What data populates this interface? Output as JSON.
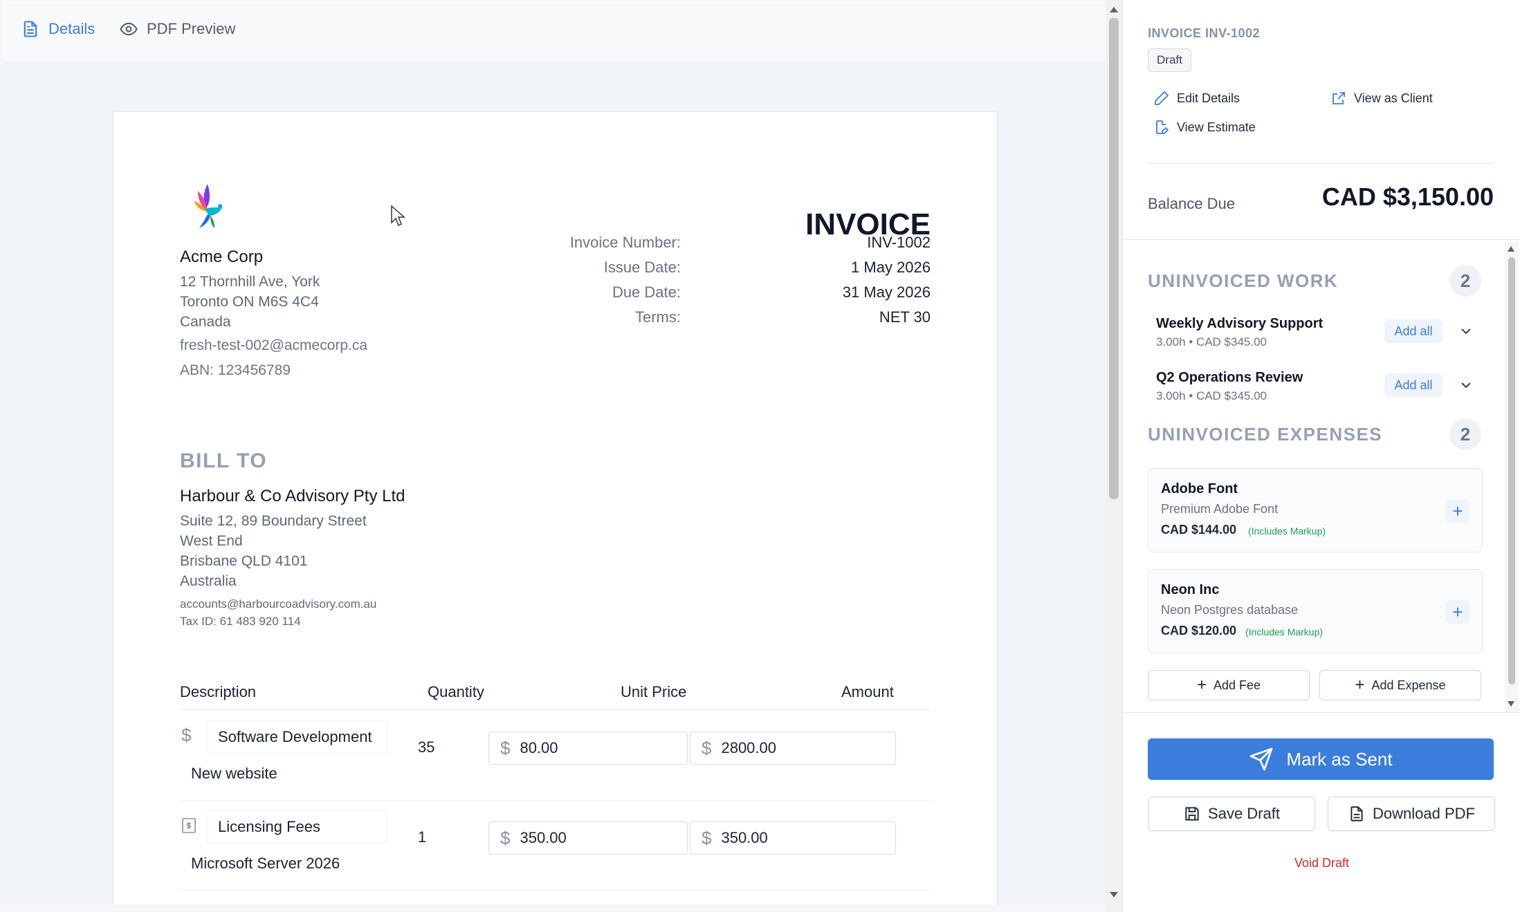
{
  "tabs": {
    "details": "Details",
    "preview": "PDF Preview"
  },
  "invoice": {
    "heading": "INVOICE",
    "meta": [
      {
        "label": "Invoice Number:",
        "value": "INV-1002"
      },
      {
        "label": "Issue Date:",
        "value": "1 May 2026"
      },
      {
        "label": "Due Date:",
        "value": "31 May 2026"
      },
      {
        "label": "Terms:",
        "value": "NET 30"
      }
    ],
    "company": {
      "name": "Acme Corp",
      "address1": "12 Thornhill Ave, York",
      "address2": "Toronto ON M6S 4C4",
      "country": "Canada",
      "email": "fresh-test-002@acmecorp.ca",
      "abn": "ABN: 123456789"
    },
    "bill_to": {
      "heading": "BILL TO",
      "name": "Harbour & Co Advisory Pty Ltd",
      "address1": "Suite 12, 89 Boundary Street",
      "address2": "West End",
      "address3": "Brisbane QLD 4101",
      "country": "Australia",
      "email": "accounts@harbourcoadvisory.com.au",
      "tax_id": "Tax ID: 61 483 920 114"
    },
    "columns": {
      "description": "Description",
      "quantity": "Quantity",
      "unit_price": "Unit Price",
      "amount": "Amount"
    },
    "lines": [
      {
        "title": "Software Development",
        "detail": "New website",
        "quantity": "35",
        "unit_price": "80.00",
        "amount": "2800.00",
        "currency_symbol": "$",
        "icon": "dollar-icon"
      },
      {
        "title": "Licensing Fees",
        "detail": "Microsoft Server 2026",
        "quantity": "1",
        "unit_price": "350.00",
        "amount": "350.00",
        "currency_symbol": "$",
        "icon": "receipt-icon"
      }
    ]
  },
  "panel": {
    "invoice_label": "INVOICE INV-1002",
    "status": "Draft",
    "actions": {
      "edit": "Edit Details",
      "view_client": "View as Client",
      "view_estimate": "View Estimate"
    },
    "balance_label": "Balance Due",
    "balance_value": "CAD $3,150.00",
    "uninvoiced_work": {
      "heading": "UNINVOICED WORK",
      "count": "2",
      "items": [
        {
          "title": "Weekly Advisory Support",
          "sub": "3.00h • CAD $345.00",
          "action": "Add all"
        },
        {
          "title": "Q2 Operations Review",
          "sub": "3.00h • CAD $345.00",
          "action": "Add all"
        }
      ]
    },
    "uninvoiced_expenses": {
      "heading": "UNINVOICED EXPENSES",
      "count": "2",
      "items": [
        {
          "title": "Adobe Font",
          "sub": "Premium Adobe Font",
          "amount": "CAD $144.00",
          "markup": "(Includes Markup)"
        },
        {
          "title": "Neon Inc",
          "sub": "Neon Postgres database",
          "amount": "CAD $120.00",
          "markup": "(Includes Markup)"
        }
      ]
    },
    "add_fee": "Add Fee",
    "add_expense": "Add Expense",
    "mark_sent": "Mark as Sent",
    "save_draft": "Save Draft",
    "download_pdf": "Download PDF",
    "void_draft": "Void Draft"
  },
  "colors": {
    "accent": "#3b7ddd",
    "danger": "#dc2626",
    "success": "#1f9d55"
  }
}
